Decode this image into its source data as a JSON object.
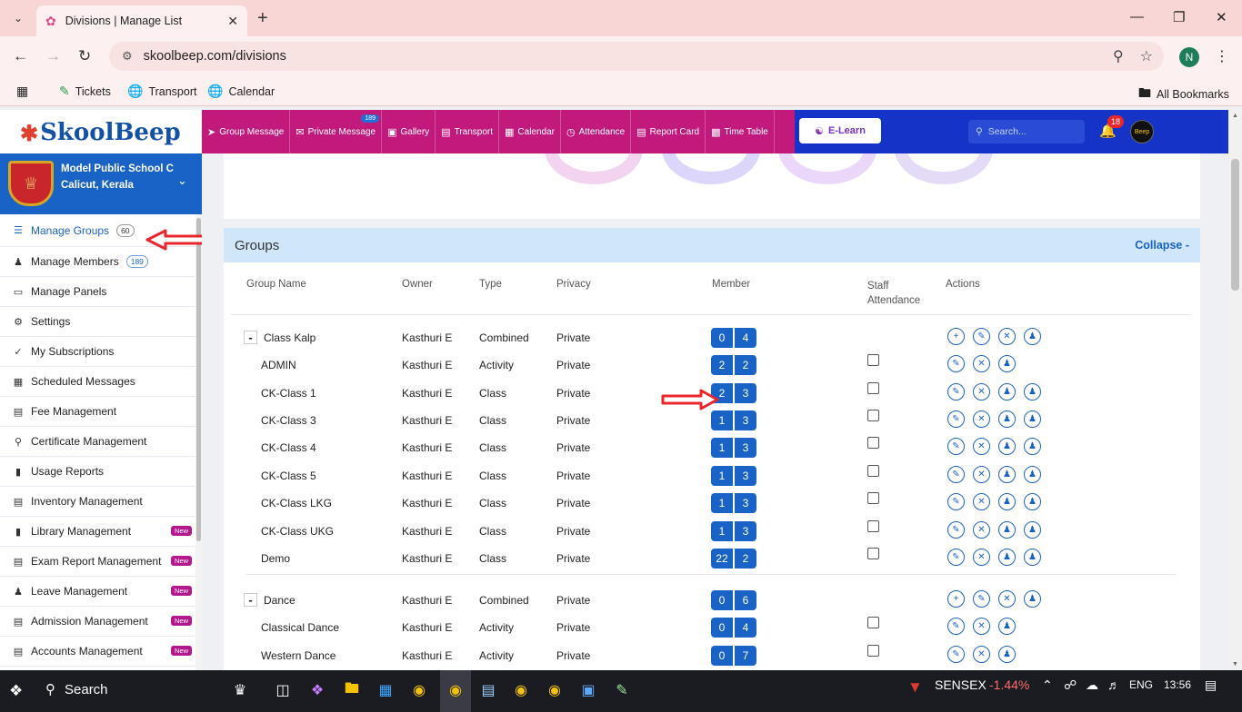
{
  "browser": {
    "tab_title": "Divisions | Manage List",
    "url": "skoolbeep.com/divisions",
    "profile_initial": "N",
    "bookmarks": [
      "Tickets",
      "Transport",
      "Calendar"
    ],
    "all_bookmarks": "All Bookmarks"
  },
  "header": {
    "logo_text": "SkoolBeep",
    "nav": [
      {
        "label": "Group Message",
        "icon": "paper-plane-icon"
      },
      {
        "label": "Private Message",
        "icon": "envelope-icon",
        "badge": "189"
      },
      {
        "label": "Gallery",
        "icon": "image-icon"
      },
      {
        "label": "Transport",
        "icon": "bus-icon"
      },
      {
        "label": "Calendar",
        "icon": "calendar-icon"
      },
      {
        "label": "Attendance",
        "icon": "clock-icon"
      },
      {
        "label": "Report Card",
        "icon": "document-icon"
      },
      {
        "label": "Time Table",
        "icon": "timetable-icon"
      }
    ],
    "elearn_label": "E-Learn",
    "search_placeholder": "Search...",
    "notifications": "18",
    "avatar_text": "Beep"
  },
  "sidebar": {
    "school_name": "Model Public School C",
    "school_place": "Calicut, Kerala",
    "items": [
      {
        "label": "Manage Groups",
        "count": "60",
        "active": true
      },
      {
        "label": "Manage Members",
        "count": "189"
      },
      {
        "label": "Manage Panels"
      },
      {
        "label": "Settings"
      },
      {
        "label": "My Subscriptions"
      },
      {
        "label": "Scheduled Messages"
      },
      {
        "label": "Fee Management"
      },
      {
        "label": "Certificate Management"
      },
      {
        "label": "Usage Reports"
      },
      {
        "label": "Inventory Management"
      },
      {
        "label": "Library Management",
        "badge": "New"
      },
      {
        "label": "Exam Report Management",
        "badge": "New"
      },
      {
        "label": "Leave Management",
        "badge": "New"
      },
      {
        "label": "Admission Management",
        "badge": "New"
      },
      {
        "label": "Accounts Management",
        "badge": "New"
      }
    ]
  },
  "groups": {
    "title": "Groups",
    "collapse_label": "Collapse -",
    "columns": {
      "name": "Group Name",
      "owner": "Owner",
      "type": "Type",
      "privacy": "Privacy",
      "member": "Member",
      "staff_attendance": "Staff Attendance",
      "actions": "Actions"
    },
    "rows": [
      {
        "name": "Class Kalp",
        "parent": true,
        "toggle": "-",
        "owner": "Kasthuri E",
        "type": "Combined",
        "privacy": "Private",
        "m1": "0",
        "m2": "4"
      },
      {
        "name": "ADMIN",
        "owner": "Kasthuri E",
        "type": "Activity",
        "privacy": "Private",
        "m1": "2",
        "m2": "2"
      },
      {
        "name": "CK-Class 1",
        "owner": "Kasthuri E",
        "type": "Class",
        "privacy": "Private",
        "m1": "2",
        "m2": "3"
      },
      {
        "name": "CK-Class 3",
        "owner": "Kasthuri E",
        "type": "Class",
        "privacy": "Private",
        "m1": "1",
        "m2": "3"
      },
      {
        "name": "CK-Class 4",
        "owner": "Kasthuri E",
        "type": "Class",
        "privacy": "Private",
        "m1": "1",
        "m2": "3"
      },
      {
        "name": "CK-Class 5",
        "owner": "Kasthuri E",
        "type": "Class",
        "privacy": "Private",
        "m1": "1",
        "m2": "3"
      },
      {
        "name": "CK-Class LKG",
        "owner": "Kasthuri E",
        "type": "Class",
        "privacy": "Private",
        "m1": "1",
        "m2": "3"
      },
      {
        "name": "CK-Class UKG",
        "owner": "Kasthuri E",
        "type": "Class",
        "privacy": "Private",
        "m1": "1",
        "m2": "3"
      },
      {
        "name": "Demo",
        "owner": "Kasthuri E",
        "type": "Class",
        "privacy": "Private",
        "m1": "22",
        "m2": "2"
      },
      {
        "name": "Dance",
        "parent": true,
        "toggle": "-",
        "owner": "Kasthuri E",
        "type": "Combined",
        "privacy": "Private",
        "m1": "0",
        "m2": "6"
      },
      {
        "name": "Classical Dance",
        "owner": "Kasthuri E",
        "type": "Activity",
        "privacy": "Private",
        "m1": "0",
        "m2": "4"
      },
      {
        "name": "Western Dance",
        "owner": "Kasthuri E",
        "type": "Activity",
        "privacy": "Private",
        "m1": "0",
        "m2": "7"
      }
    ]
  },
  "taskbar": {
    "search_label": "Search",
    "sensex_label": "SENSEX",
    "sensex_value": "-1.44%",
    "lang": "ENG",
    "time": "13:56"
  },
  "colors": {
    "nav_magenta": "#c2197d",
    "nav_blue": "#1533c7",
    "primary": "#1a63c6",
    "new_badge": "#b5178e",
    "annotation_arrow": "#e8262b"
  }
}
